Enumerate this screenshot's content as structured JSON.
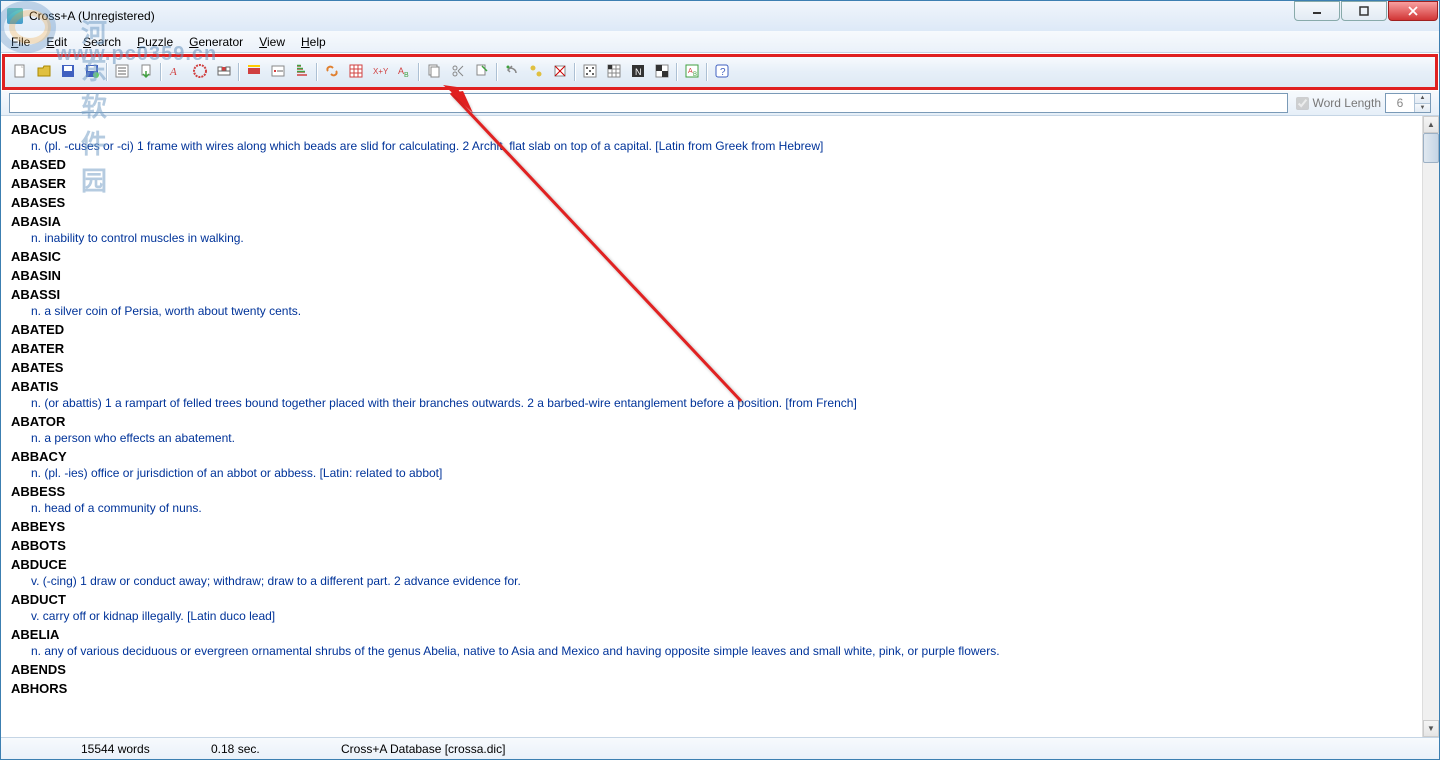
{
  "window": {
    "title": "Cross+A (Unregistered)"
  },
  "menus": [
    "File",
    "Edit",
    "Search",
    "Puzzle",
    "Generator",
    "View",
    "Help"
  ],
  "toolbar_icons": [
    "new",
    "open",
    "save",
    "save-as",
    "|",
    "word-list",
    "export",
    "|",
    "anagram",
    "filter",
    "crossword",
    "|",
    "rebus",
    "hint",
    "sort",
    "|",
    "link",
    "grid",
    "formula",
    "alpha",
    "|",
    "copy",
    "cut",
    "paste",
    "|",
    "undo",
    "redo",
    "clear",
    "|",
    "puzzle1",
    "puzzle2",
    "puzzle3",
    "puzzle4",
    "|",
    "dict",
    "|",
    "help"
  ],
  "search": {
    "placeholder": ""
  },
  "wordlength": {
    "label": "Word Length",
    "value": "6"
  },
  "entries": [
    {
      "w": "ABACUS",
      "d": "n. (pl. -cuses or -ci) 1 frame with wires along which beads are slid for calculating. 2 Archit. flat slab on top of a capital. [Latin from Greek from Hebrew]"
    },
    {
      "w": "ABASED"
    },
    {
      "w": "ABASER"
    },
    {
      "w": "ABASES"
    },
    {
      "w": "ABASIA",
      "d": "n. inability to control muscles in walking."
    },
    {
      "w": "ABASIC"
    },
    {
      "w": "ABASIN"
    },
    {
      "w": "ABASSI",
      "d": "n. a silver coin of Persia, worth about twenty cents."
    },
    {
      "w": "ABATED"
    },
    {
      "w": "ABATER"
    },
    {
      "w": "ABATES"
    },
    {
      "w": "ABATIS",
      "d": "n. (or abattis) 1 a rampart of felled trees bound together placed with their branches outwards. 2 a barbed-wire entanglement before a position. [from French]"
    },
    {
      "w": "ABATOR",
      "d": "n. a person who effects an abatement."
    },
    {
      "w": "ABBACY",
      "d": "n. (pl. -ies) office or jurisdiction of an abbot or abbess. [Latin: related to abbot]"
    },
    {
      "w": "ABBESS",
      "d": "n. head of a community of nuns."
    },
    {
      "w": "ABBEYS"
    },
    {
      "w": "ABBOTS"
    },
    {
      "w": "ABDUCE",
      "d": "v. (-cing) 1 draw or conduct away; withdraw; draw to a different part. 2 advance evidence for."
    },
    {
      "w": "ABDUCT",
      "d": "v. carry off or kidnap illegally. [Latin duco lead]"
    },
    {
      "w": "ABELIA",
      "d": "n. any of various deciduous or evergreen ornamental shrubs of the genus Abelia, native to Asia and Mexico and having opposite simple leaves and small white, pink, or purple flowers."
    },
    {
      "w": "ABENDS"
    },
    {
      "w": "ABHORS"
    }
  ],
  "status": {
    "words": "15544 words",
    "time": "0.18 sec.",
    "db": "Cross+A Database [crossa.dic]"
  },
  "watermark": {
    "url": "www.pc0359.cn",
    "cn": "河东软件园"
  }
}
